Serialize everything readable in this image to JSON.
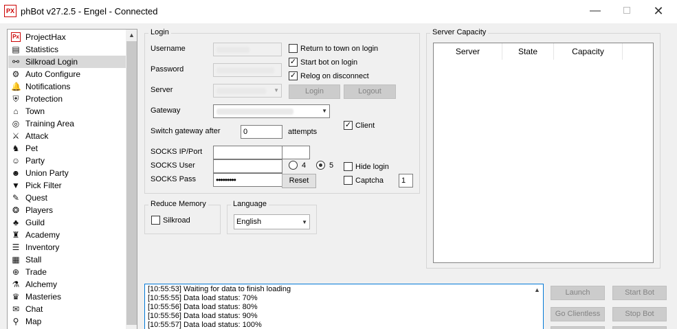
{
  "window": {
    "app_icon_text": "PX",
    "title": "phBot v27.2.5 - Engel - Connected"
  },
  "sidebar": {
    "items": [
      {
        "label": "ProjectHax",
        "icon": "projecthax-icon",
        "glyph": "Px"
      },
      {
        "label": "Statistics",
        "icon": "statistics-icon",
        "glyph": "▤"
      },
      {
        "label": "Silkroad Login",
        "icon": "silkroad-login-icon",
        "glyph": "⚯"
      },
      {
        "label": "Auto Configure",
        "icon": "auto-configure-icon",
        "glyph": "⚙"
      },
      {
        "label": "Notifications",
        "icon": "notifications-icon",
        "glyph": "🔔"
      },
      {
        "label": "Protection",
        "icon": "protection-icon",
        "glyph": "⛨"
      },
      {
        "label": "Town",
        "icon": "town-icon",
        "glyph": "⌂"
      },
      {
        "label": "Training Area",
        "icon": "training-area-icon",
        "glyph": "◎"
      },
      {
        "label": "Attack",
        "icon": "attack-icon",
        "glyph": "⚔"
      },
      {
        "label": "Pet",
        "icon": "pet-icon",
        "glyph": "♞"
      },
      {
        "label": "Party",
        "icon": "party-icon",
        "glyph": "☺"
      },
      {
        "label": "Union Party",
        "icon": "union-party-icon",
        "glyph": "☻"
      },
      {
        "label": "Pick Filter",
        "icon": "pick-filter-icon",
        "glyph": "▼"
      },
      {
        "label": "Quest",
        "icon": "quest-icon",
        "glyph": "✎"
      },
      {
        "label": "Players",
        "icon": "players-icon",
        "glyph": "❂"
      },
      {
        "label": "Guild",
        "icon": "guild-icon",
        "glyph": "♣"
      },
      {
        "label": "Academy",
        "icon": "academy-icon",
        "glyph": "♜"
      },
      {
        "label": "Inventory",
        "icon": "inventory-icon",
        "glyph": "☰"
      },
      {
        "label": "Stall",
        "icon": "stall-icon",
        "glyph": "▦"
      },
      {
        "label": "Trade",
        "icon": "trade-icon",
        "glyph": "⊕"
      },
      {
        "label": "Alchemy",
        "icon": "alchemy-icon",
        "glyph": "⚗"
      },
      {
        "label": "Masteries",
        "icon": "masteries-icon",
        "glyph": "♛"
      },
      {
        "label": "Chat",
        "icon": "chat-icon",
        "glyph": "✉"
      },
      {
        "label": "Map",
        "icon": "map-icon",
        "glyph": "⚲"
      }
    ],
    "active_index": 2
  },
  "login": {
    "group_title": "Login",
    "username_label": "Username",
    "password_label": "Password",
    "server_label": "Server",
    "gateway_label": "Gateway",
    "switch_gateway_label": "Switch gateway after",
    "switch_gateway_value": "0",
    "attempts_label": "attempts",
    "socks_ip_label": "SOCKS IP/Port",
    "socks_user_label": "SOCKS User",
    "socks_pass_label": "SOCKS Pass",
    "socks_pass_value": "•••••••••",
    "socks_version_4": "4",
    "socks_version_5": "5",
    "socks_version_selected": "5",
    "return_to_town_label": "Return to town on login",
    "return_to_town_checked": false,
    "start_bot_label": "Start bot on login",
    "start_bot_checked": true,
    "relog_label": "Relog on disconnect",
    "relog_checked": true,
    "login_button": "Login",
    "logout_button": "Logout",
    "client_label": "Client",
    "client_checked": true,
    "hide_login_label": "Hide login",
    "hide_login_checked": false,
    "captcha_label": "Captcha",
    "captcha_checked": false,
    "captcha_value": "1",
    "reset_button": "Reset"
  },
  "reduce_memory": {
    "group_title": "Reduce Memory",
    "silkroad_label": "Silkroad",
    "silkroad_checked": false
  },
  "language": {
    "group_title": "Language",
    "selected": "English"
  },
  "server_capacity": {
    "group_title": "Server Capacity",
    "columns": [
      "Server",
      "State",
      "Capacity"
    ]
  },
  "log": {
    "lines": [
      "[10:55:53] Waiting for data to finish loading",
      "[10:55:55] Data load status: 70%",
      "[10:55:56] Data load status: 80%",
      "[10:55:56] Data load status: 90%",
      "[10:55:57] Data load status: 100%"
    ]
  },
  "actions": {
    "launch": "Launch",
    "start_bot": "Start Bot",
    "go_clientless": "Go Clientless",
    "stop_bot": "Stop Bot"
  }
}
